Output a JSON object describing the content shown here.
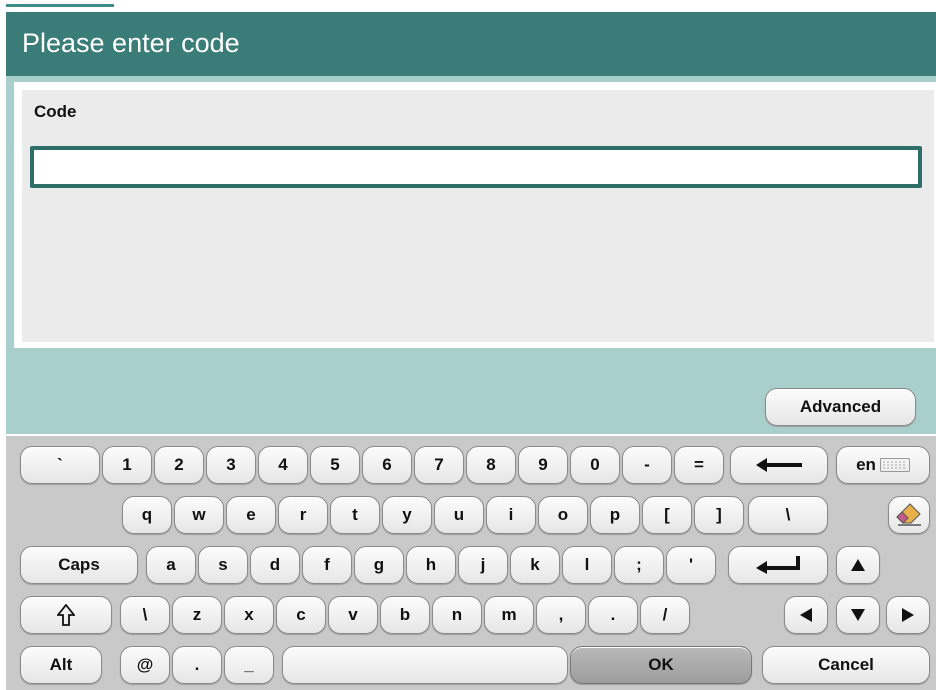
{
  "header": {
    "title": "Please enter code"
  },
  "form": {
    "code_label": "Code",
    "code_value": "",
    "code_placeholder": ""
  },
  "actions": {
    "advanced_label": "Advanced",
    "ok_label": "OK",
    "cancel_label": "Cancel"
  },
  "keyboard": {
    "row1": [
      "`",
      "1",
      "2",
      "3",
      "4",
      "5",
      "6",
      "7",
      "8",
      "9",
      "0",
      "-",
      "="
    ],
    "row2": [
      "q",
      "w",
      "e",
      "r",
      "t",
      "y",
      "u",
      "i",
      "o",
      "p",
      "[",
      "]",
      "\\"
    ],
    "row3": [
      "a",
      "s",
      "d",
      "f",
      "g",
      "h",
      "j",
      "k",
      "l",
      ";",
      "'"
    ],
    "row4": [
      "\\",
      "z",
      "x",
      "c",
      "v",
      "b",
      "n",
      "m",
      ",",
      ".",
      "/"
    ],
    "row5": [
      "@",
      ".",
      "_"
    ],
    "caps_label": "Caps",
    "alt_label": "Alt",
    "language_label": "en",
    "icons": {
      "backspace": "backspace-arrow-icon",
      "enter": "enter-arrow-icon",
      "shift": "shift-arrow-icon",
      "eraser": "eraser-icon",
      "keyboard": "keyboard-layout-icon",
      "up": "arrow-up-icon",
      "left": "arrow-left-icon",
      "down": "arrow-down-icon",
      "right": "arrow-right-icon"
    }
  },
  "colors": {
    "title_bar": "#3a7d78",
    "panel": "#a9cfcc",
    "input_border": "#2e6e69",
    "keyboard_bg": "#c9c9c9"
  }
}
